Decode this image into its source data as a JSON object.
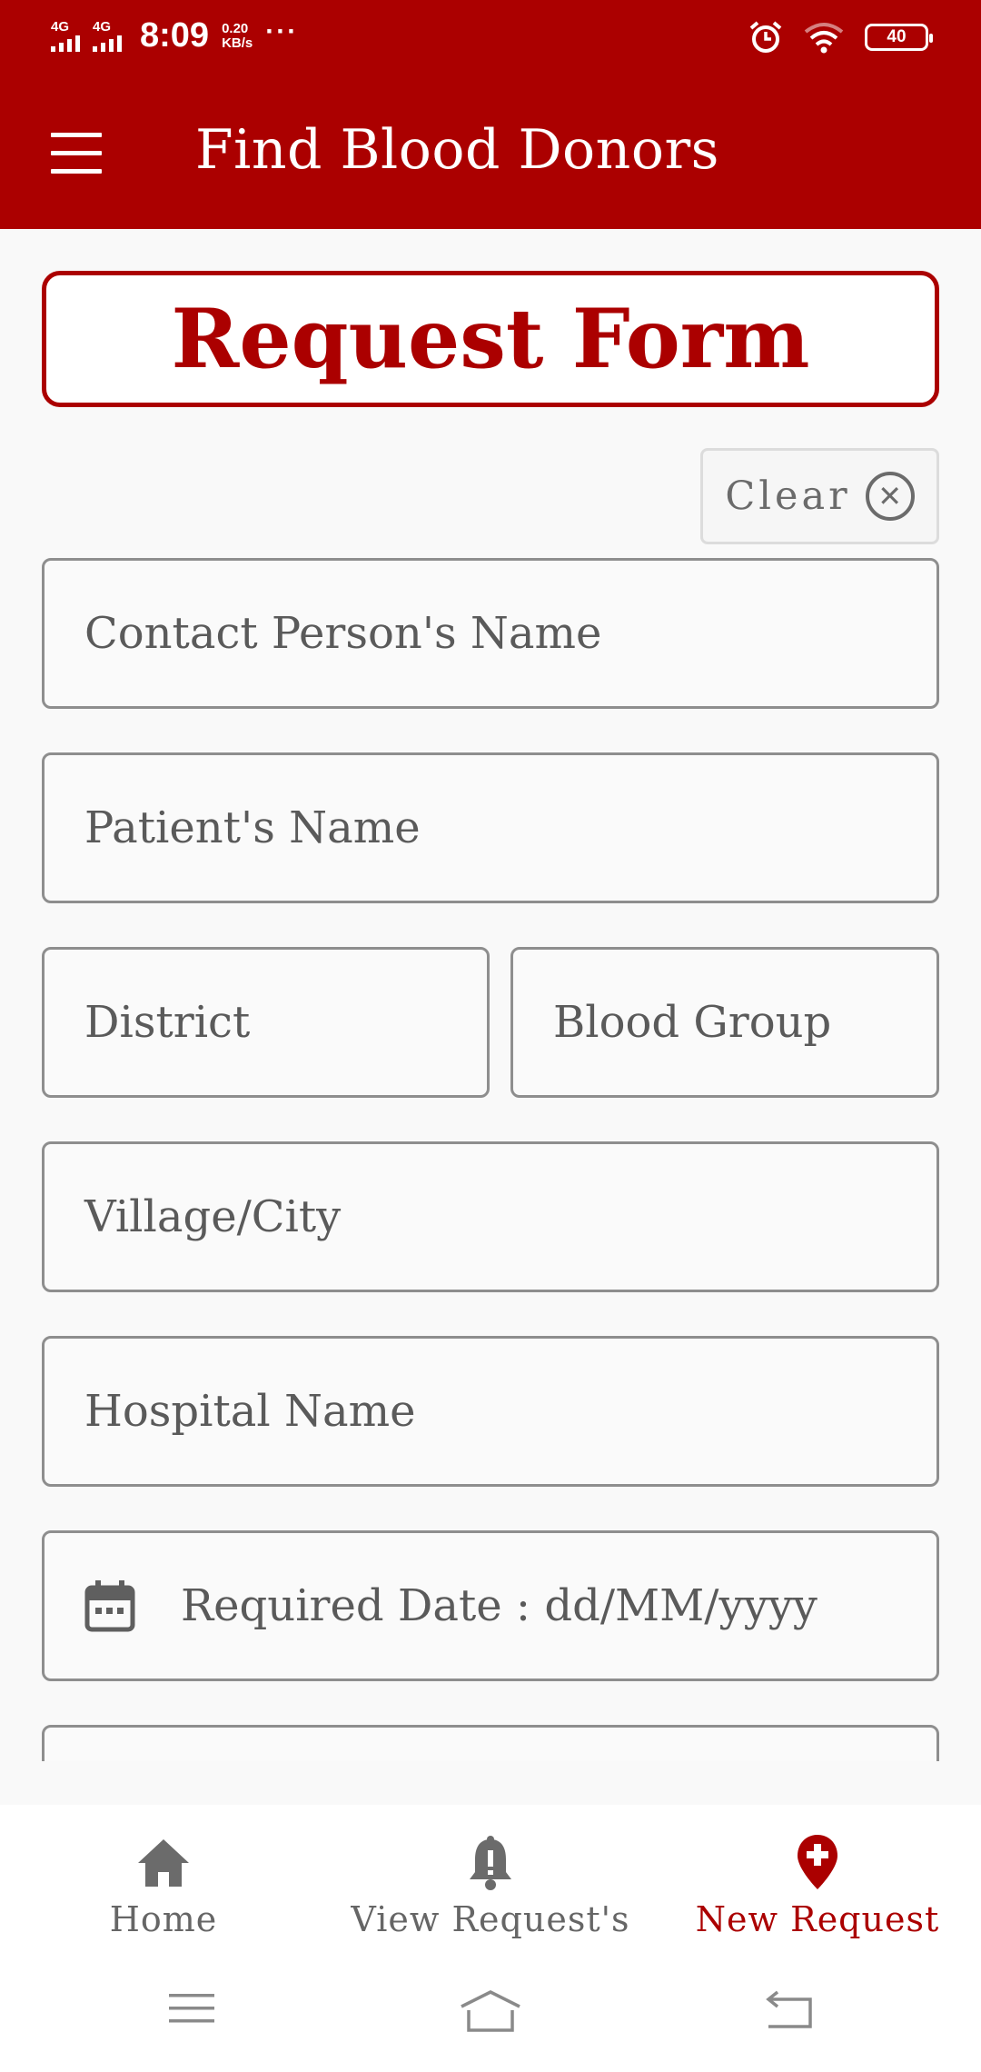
{
  "status_bar": {
    "network_1": "4G",
    "network_2": "4G",
    "time": "8:09",
    "speed_value": "0.20",
    "speed_unit": "KB/s",
    "more": "···",
    "battery": "40"
  },
  "app_bar": {
    "title": "Find Blood Donors"
  },
  "form": {
    "title": "Request Form",
    "clear_label": "Clear",
    "fields": {
      "contact_name": "Contact Person's Name",
      "patient_name": "Patient's Name",
      "district": "District",
      "blood_group": "Blood Group",
      "village_city": "Village/City",
      "hospital_name": "Hospital Name",
      "required_date": "Required Date : dd/MM/yyyy"
    }
  },
  "bottom_nav": {
    "items": [
      {
        "label": "Home",
        "icon": "home-icon"
      },
      {
        "label": "View Request's",
        "icon": "bell-icon"
      },
      {
        "label": "New Request",
        "icon": "location-plus-icon",
        "active": true
      }
    ]
  },
  "colors": {
    "primary": "#ab0000",
    "field_border": "#8e8e8e",
    "text_gray": "#5a5a5a"
  }
}
